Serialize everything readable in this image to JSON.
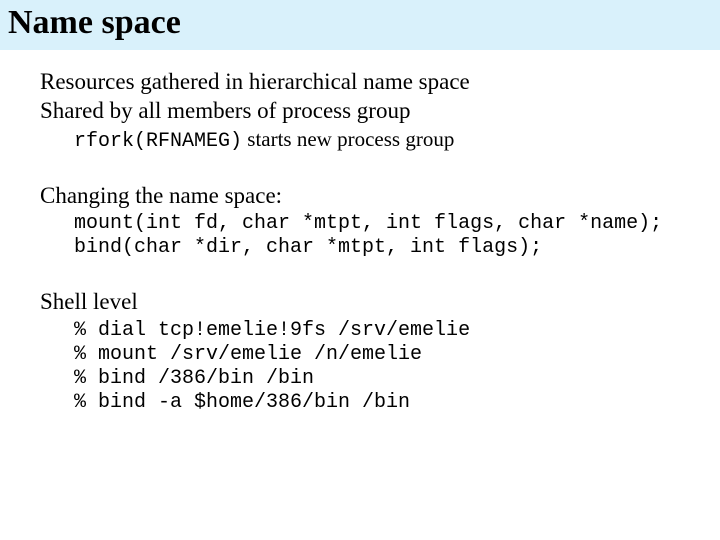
{
  "title": "Name space",
  "line1": "Resources gathered in hierarchical name space",
  "line2": "Shared by all members of process group",
  "rfork_code": "rfork(RFNAMEG)",
  "rfork_tail": " starts new process group",
  "changing_heading": "Changing the name space:",
  "mount_sig": "mount(int fd, char *mtpt, int flags, char *name);",
  "bind_sig": "bind(char *dir, char *mtpt, int flags);",
  "shell_heading": "Shell level",
  "shell_cmds": "% dial tcp!emelie!9fs /srv/emelie\n% mount /srv/emelie /n/emelie\n% bind /386/bin /bin\n% bind -a $home/386/bin /bin"
}
